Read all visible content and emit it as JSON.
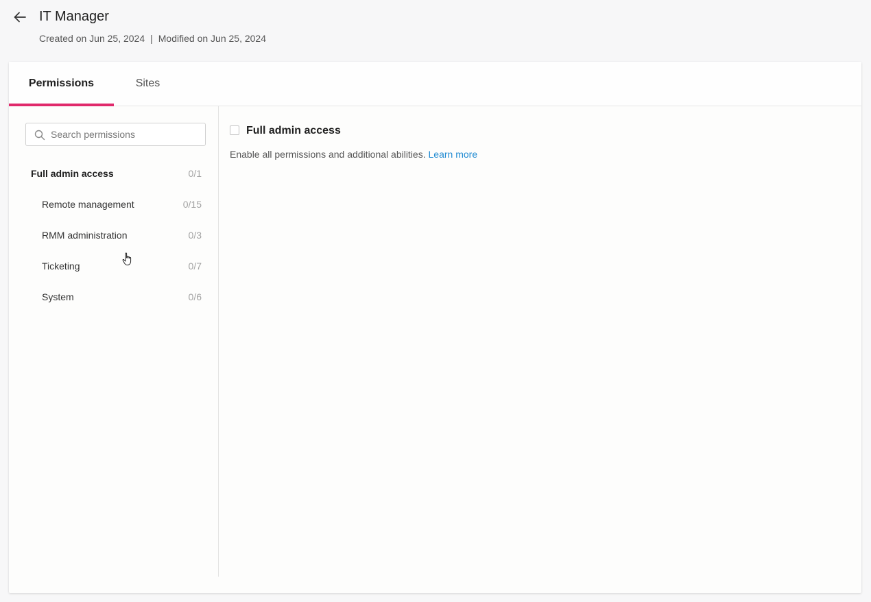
{
  "header": {
    "back_icon": "arrow-left-icon",
    "title": "IT Manager",
    "created": "Created on Jun 25, 2024",
    "separator": "|",
    "modified": "Modified on Jun 25, 2024"
  },
  "tabs": [
    {
      "label": "Permissions",
      "active": true
    },
    {
      "label": "Sites",
      "active": false
    }
  ],
  "search": {
    "placeholder": "Search permissions",
    "value": "",
    "icon": "search-icon"
  },
  "permissions": [
    {
      "label": "Full admin access",
      "count": "0/1",
      "level": "top"
    },
    {
      "label": "Remote management",
      "count": "0/15",
      "level": "sub"
    },
    {
      "label": "RMM administration",
      "count": "0/3",
      "level": "sub"
    },
    {
      "label": "Ticketing",
      "count": "0/7",
      "level": "sub"
    },
    {
      "label": "System",
      "count": "0/6",
      "level": "sub"
    }
  ],
  "detail": {
    "checkbox_checked": false,
    "title": "Full admin access",
    "description": "Enable all permissions and additional abilities.",
    "learn_more": "Learn more"
  },
  "colors": {
    "accent": "#e0296b",
    "link": "#1f8ad2",
    "background": "#f7f7f8"
  }
}
